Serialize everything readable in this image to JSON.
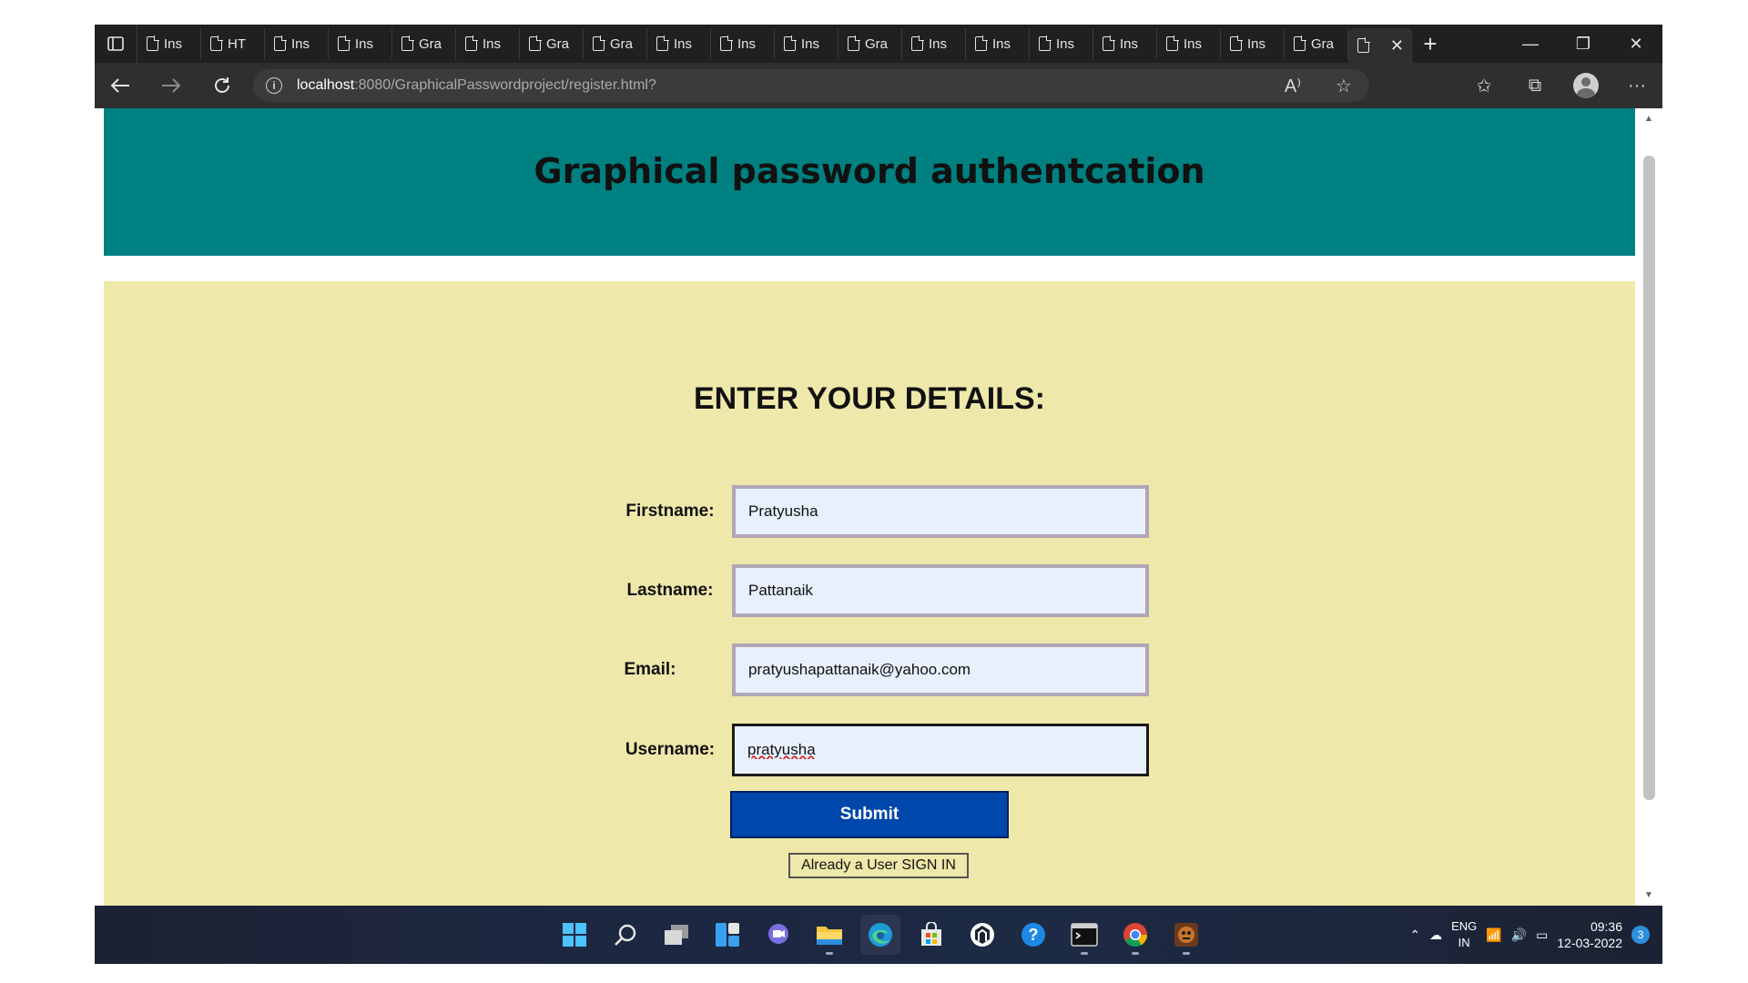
{
  "browser": {
    "tabs": [
      {
        "label": "Ins"
      },
      {
        "label": "HT"
      },
      {
        "label": "Ins"
      },
      {
        "label": "Ins"
      },
      {
        "label": "Gra"
      },
      {
        "label": "Ins"
      },
      {
        "label": "Gra"
      },
      {
        "label": "Gra"
      },
      {
        "label": "Ins"
      },
      {
        "label": "Ins"
      },
      {
        "label": "Ins"
      },
      {
        "label": "Gra"
      },
      {
        "label": "Ins"
      },
      {
        "label": "Ins"
      },
      {
        "label": "Ins"
      },
      {
        "label": "Ins"
      },
      {
        "label": "Ins"
      },
      {
        "label": "Ins"
      },
      {
        "label": "Gra"
      },
      {
        "label": "",
        "active": true
      }
    ],
    "url_host": "localhost",
    "url_path": ":8080/GraphicalPasswordproject/register.html?"
  },
  "page": {
    "title": "Graphical password authentcation",
    "form_heading": "ENTER YOUR DETAILS:",
    "fields": {
      "firstname": {
        "label": "Firstname:",
        "value": "Pratyusha"
      },
      "lastname": {
        "label": "Lastname:",
        "value": "Pattanaik"
      },
      "email": {
        "label": "Email:",
        "value": "pratyushapattanaik@yahoo.com"
      },
      "username": {
        "label": "Username:",
        "value": "pratyusha"
      }
    },
    "submit_label": "Submit",
    "signin_label": "Already a User SIGN IN",
    "colors": {
      "header": "#008080",
      "content": "#eee8aa",
      "submit": "#0047ab"
    }
  },
  "taskbar": {
    "icons": [
      "windows-start-icon",
      "search-icon",
      "task-view-icon",
      "widgets-icon",
      "chat-icon",
      "file-explorer-icon",
      "edge-browser-icon",
      "store-icon",
      "app-icon",
      "help-icon",
      "terminal-icon",
      "chrome-icon",
      "app-icon-2"
    ],
    "language": "ENG",
    "region": "IN",
    "time": "09:36",
    "date": "12-03-2022",
    "notification_count": "3"
  }
}
